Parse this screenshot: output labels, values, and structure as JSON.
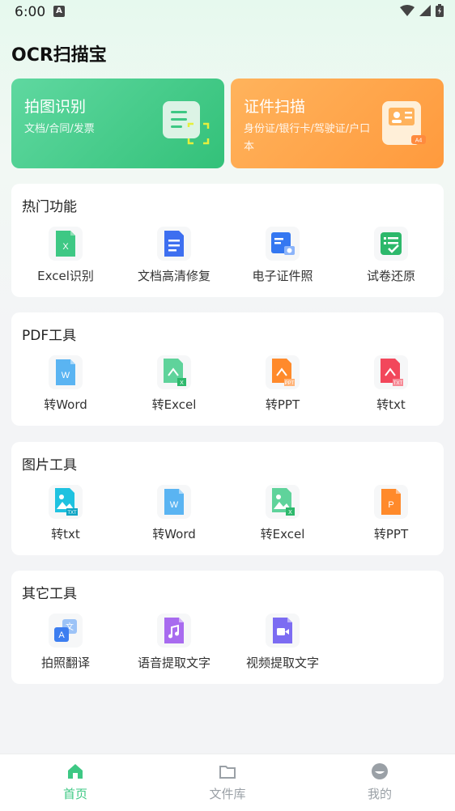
{
  "status": {
    "time": "6:00",
    "indicator": "A"
  },
  "app": {
    "title": "OCR扫描宝"
  },
  "top_cards": [
    {
      "title": "拍图识别",
      "subtitle": "文档/合同/发票"
    },
    {
      "title": "证件扫描",
      "subtitle": "身份证/银行卡/驾驶证/户口本"
    }
  ],
  "sections": [
    {
      "title": "热门功能",
      "items": [
        {
          "label": "Excel识别",
          "icon": "excel-sheet-icon"
        },
        {
          "label": "文档高清修复",
          "icon": "document-icon"
        },
        {
          "label": "电子证件照",
          "icon": "id-photo-icon"
        },
        {
          "label": "试卷还原",
          "icon": "checklist-icon"
        }
      ]
    },
    {
      "title": "PDF工具",
      "items": [
        {
          "label": "转Word",
          "icon": "word-file-icon"
        },
        {
          "label": "转Excel",
          "icon": "pdf-to-excel-icon"
        },
        {
          "label": "转PPT",
          "icon": "pdf-to-ppt-icon"
        },
        {
          "label": "转txt",
          "icon": "pdf-to-txt-icon"
        }
      ]
    },
    {
      "title": "图片工具",
      "items": [
        {
          "label": "转txt",
          "icon": "image-to-txt-icon"
        },
        {
          "label": "转Word",
          "icon": "word-file-icon"
        },
        {
          "label": "转Excel",
          "icon": "image-to-excel-icon"
        },
        {
          "label": "转PPT",
          "icon": "ppt-file-icon"
        }
      ]
    },
    {
      "title": "其它工具",
      "items": [
        {
          "label": "拍照翻译",
          "icon": "translate-icon"
        },
        {
          "label": "语音提取文字",
          "icon": "audio-file-icon"
        },
        {
          "label": "视频提取文字",
          "icon": "video-file-icon"
        }
      ]
    }
  ],
  "bottom_nav": [
    {
      "label": "首页",
      "icon": "home-icon",
      "active": true
    },
    {
      "label": "文件库",
      "icon": "folder-icon",
      "active": false
    },
    {
      "label": "我的",
      "icon": "profile-icon",
      "active": false
    }
  ],
  "colors": {
    "accent": "#3ec884",
    "green_card": "#33c179",
    "orange_card": "#ff9a3d"
  }
}
